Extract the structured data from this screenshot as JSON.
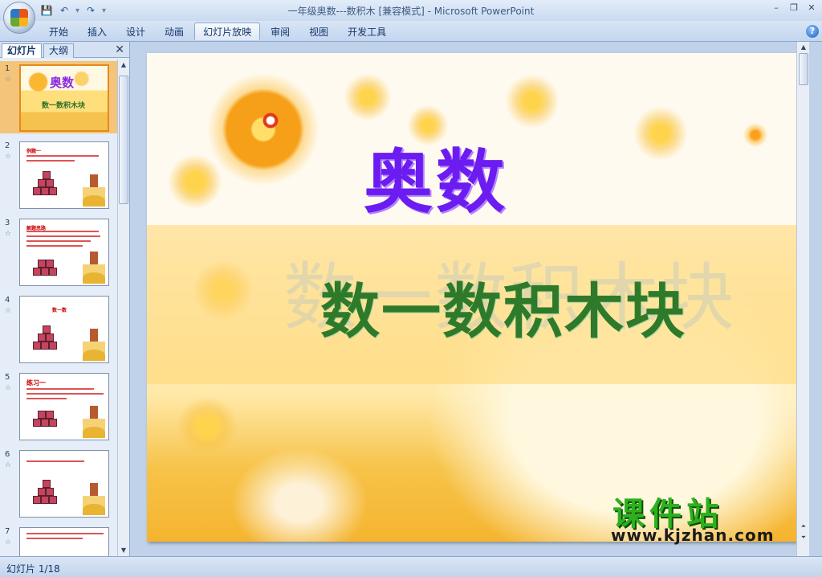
{
  "window": {
    "title": "一年级奥数---数积木 [兼容模式] - Microsoft PowerPoint"
  },
  "ribbon": {
    "tabs": [
      {
        "label": "开始"
      },
      {
        "label": "插入"
      },
      {
        "label": "设计"
      },
      {
        "label": "动画"
      },
      {
        "label": "幻灯片放映"
      },
      {
        "label": "审阅"
      },
      {
        "label": "视图"
      },
      {
        "label": "开发工具"
      }
    ],
    "active_tab": "幻灯片放映",
    "help_label": "?"
  },
  "panel": {
    "tab_slides": "幻灯片",
    "tab_outline": "大纲",
    "close_label": "✕"
  },
  "thumbnails": [
    {
      "number": "1",
      "title": "奥数",
      "subtitle": "数一数积木块"
    },
    {
      "number": "2",
      "title": "例题一"
    },
    {
      "number": "3",
      "title": "解题思路"
    },
    {
      "number": "4",
      "title": "数一数"
    },
    {
      "number": "5",
      "title": "练习一"
    },
    {
      "number": "6",
      "title": ""
    },
    {
      "number": "7",
      "title": ""
    }
  ],
  "slide": {
    "title": "奥数",
    "subtitle": "数一数积木块",
    "shadow_text": "数一数积木块",
    "watermark": "课件站",
    "watermark_url": "www.kjzhan.com"
  },
  "status": {
    "slide_indicator": "幻灯片 1/18"
  },
  "colors": {
    "ribbon_bg": "#c9daf0",
    "slide_title": "#6b1cf0",
    "slide_subtitle": "#2f7a2a",
    "selected_thumb": "#f4c47a",
    "watermark": "#2eb01c"
  }
}
